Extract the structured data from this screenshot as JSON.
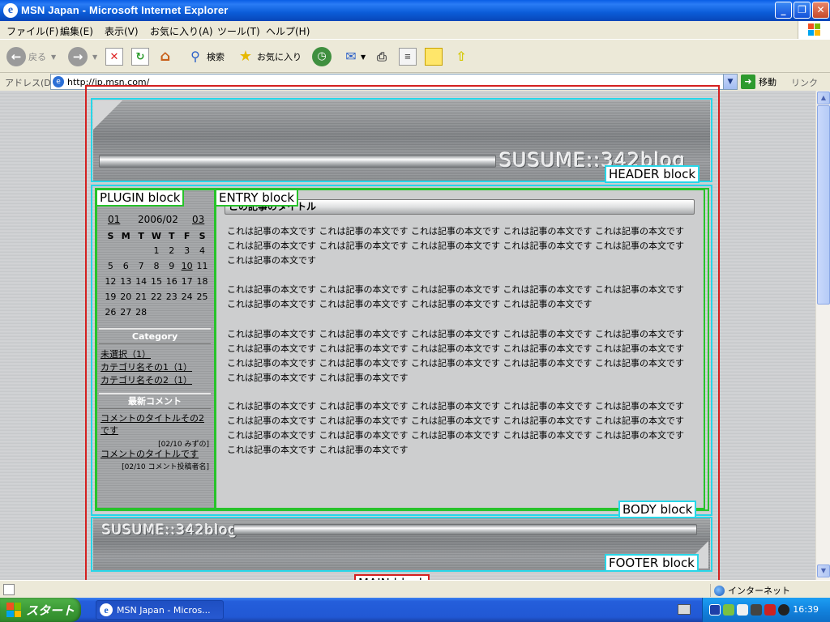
{
  "window": {
    "title": "MSN Japan - Microsoft Internet Explorer",
    "min": "_",
    "max": "❐",
    "close": "✕"
  },
  "menu": [
    "ファイル(F)",
    "編集(E)",
    "表示(V)",
    "お気に入り(A)",
    "ツール(T)",
    "ヘルプ(H)"
  ],
  "toolbar": {
    "back": "戻る",
    "search": "検索",
    "favorites": "お気に入り"
  },
  "address": {
    "label": "アドレス(D)",
    "url": "http://jp.msn.com/",
    "go": "移動",
    "links": "リンク"
  },
  "annotations": {
    "header": "HEADER block",
    "plugin": "PLUGIN block",
    "entry": "ENTRY block",
    "body": "BODY block",
    "footer": "FOOTER block",
    "main": "MAIN block"
  },
  "blog": {
    "logo_header": "SUSUME::342blog",
    "logo_footer": "SUSUME::342blog"
  },
  "calendar": {
    "prev": "01",
    "month": "2006/02",
    "next": "03",
    "weekdays": [
      "S",
      "M",
      "T",
      "W",
      "T",
      "F",
      "S"
    ],
    "weeks": [
      [
        "",
        "",
        "",
        "1",
        "2",
        "3",
        "4"
      ],
      [
        "5",
        "6",
        "7",
        "8",
        "9",
        "10",
        "11"
      ],
      [
        "12",
        "13",
        "14",
        "15",
        "16",
        "17",
        "18"
      ],
      [
        "19",
        "20",
        "21",
        "22",
        "23",
        "24",
        "25"
      ],
      [
        "26",
        "27",
        "28",
        "",
        "",
        "",
        ""
      ]
    ],
    "linked_day": "10"
  },
  "category": {
    "title": "Category",
    "items": [
      "未選択（1）",
      "カテゴリ名その1（1）",
      "カテゴリ名その2（1）"
    ]
  },
  "comments": {
    "title": "最新コメント",
    "items": [
      {
        "title": "コメントのタイトルその2です",
        "meta": "[02/10 みずの]"
      },
      {
        "title": "コメントのタイトルです",
        "meta": "[02/10 コメント投稿者名]"
      }
    ]
  },
  "entry": {
    "title": "この記事のタイトル",
    "paragraphs": [
      "これは記事の本文です これは記事の本文です これは記事の本文です これは記事の本文です これは記事の本文です これは記事の本文です これは記事の本文です これは記事の本文です これは記事の本文です これは記事の本文です これは記事の本文です",
      "これは記事の本文です これは記事の本文です これは記事の本文です これは記事の本文です これは記事の本文です これは記事の本文です これは記事の本文です これは記事の本文です これは記事の本文です",
      "これは記事の本文です これは記事の本文です これは記事の本文です これは記事の本文です これは記事の本文です これは記事の本文です これは記事の本文です これは記事の本文です これは記事の本文です これは記事の本文です これは記事の本文です これは記事の本文です これは記事の本文です これは記事の本文です これは記事の本文です これは記事の本文です これは記事の本文です",
      "これは記事の本文です これは記事の本文です これは記事の本文です これは記事の本文です これは記事の本文です これは記事の本文です これは記事の本文です これは記事の本文です これは記事の本文です これは記事の本文です これは記事の本文です これは記事の本文です これは記事の本文です これは記事の本文です これは記事の本文です これは記事の本文です これは記事の本文です"
    ]
  },
  "status": {
    "zone": "インターネット"
  },
  "taskbar": {
    "start": "スタート",
    "task": "MSN Japan - Micros...",
    "clock": "16:39"
  }
}
